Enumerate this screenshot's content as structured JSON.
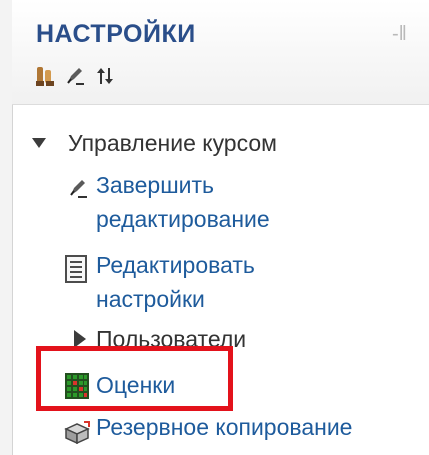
{
  "block": {
    "title": "НАСТРОЙКИ",
    "dock_control": "-‖",
    "header_icons": [
      "settings-tools-icon",
      "edit-pen-icon",
      "move-arrows-icon"
    ]
  },
  "tree": {
    "course_admin": {
      "label": "Управление курсом",
      "expanded": true
    },
    "items": [
      {
        "label_line1": "Завершить",
        "label_line2": "редактирование",
        "icon": "pen-icon"
      },
      {
        "label_line1": "Редактировать",
        "label_line2": "настройки",
        "icon": "document-settings-icon"
      },
      {
        "label": "Пользователи",
        "icon": "collapsed-arrow-icon"
      },
      {
        "label": "Оценки",
        "icon": "grades-grid-icon"
      },
      {
        "label": "Резервное копирование",
        "icon": "backup-box-icon"
      }
    ]
  },
  "colors": {
    "title": "#2a4e8a",
    "link": "#1e5b9c",
    "text": "#333333",
    "highlight": "#e3121b"
  }
}
